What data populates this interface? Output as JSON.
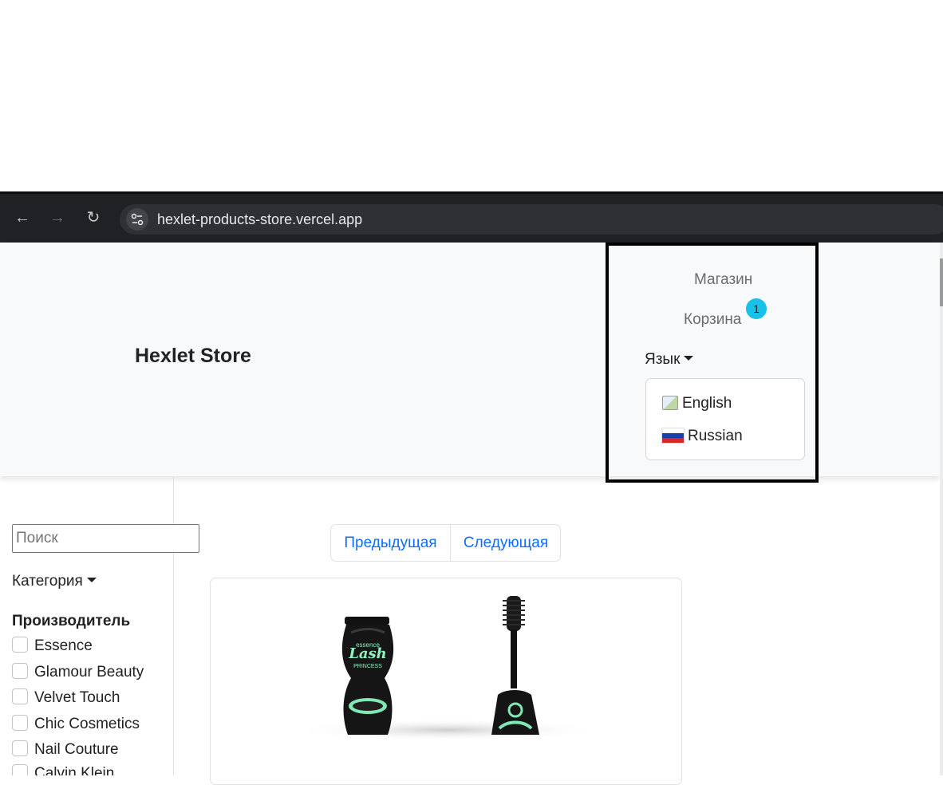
{
  "browser": {
    "url": "hexlet-products-store.vercel.app",
    "back_icon": "arrow-left-icon",
    "forward_icon": "arrow-right-icon",
    "reload_icon": "reload-icon",
    "site_info_icon": "tune-icon"
  },
  "header": {
    "brand": "Hexlet Store",
    "nav": {
      "shop": "Магазин",
      "cart": "Корзина",
      "cart_count": "1"
    },
    "language": {
      "toggle_label": "Язык",
      "options": [
        {
          "label": "English",
          "icon": "broken-image-icon"
        },
        {
          "label": "Russian",
          "icon": "russia-flag-icon"
        }
      ]
    }
  },
  "sidebar": {
    "search_placeholder": "Поиск",
    "category_label": "Категория",
    "maker_title": "Производитель",
    "makers": [
      "Essence",
      "Glamour Beauty",
      "Velvet Touch",
      "Chic Cosmetics",
      "Nail Couture",
      "Calvin Klein"
    ]
  },
  "pagination": {
    "prev": "Предыдущая",
    "next": "Следующая"
  },
  "product": {
    "label_text": "essence Lash PRINCESS"
  },
  "colors": {
    "header_bg": "#f8f9fa",
    "link_blue": "#0d6efd",
    "badge": "#17c1e8",
    "browser_bar": "#202124"
  }
}
